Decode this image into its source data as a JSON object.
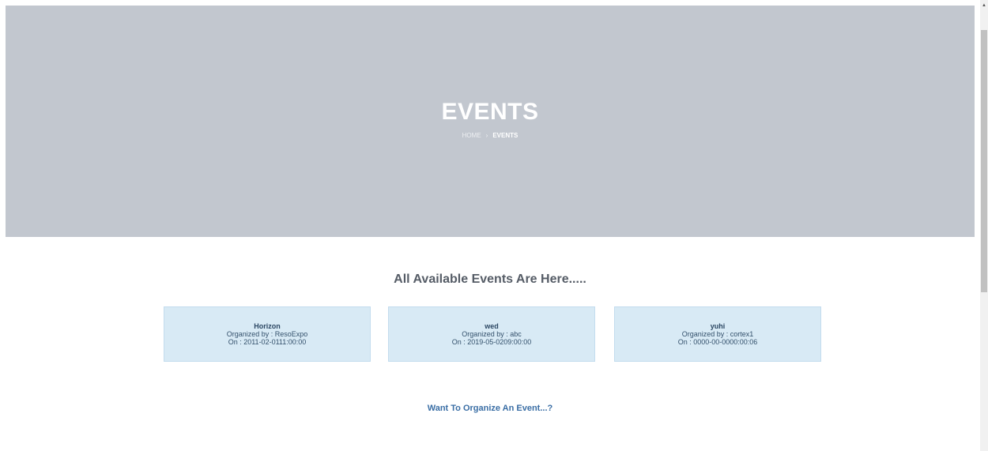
{
  "hero": {
    "title": "EVENTS",
    "breadcrumb": {
      "home": "HOME",
      "separator": "›",
      "current": "EVENTS"
    }
  },
  "main": {
    "section_title": "All Available Events Are Here.....",
    "events": [
      {
        "name": "Horizon",
        "organizer": "Organized by : ResoExpo",
        "date": "On : 2011-02-0111:00:00"
      },
      {
        "name": "wed",
        "organizer": "Organized by : abc",
        "date": "On : 2019-05-0209:00:00"
      },
      {
        "name": "yuhi",
        "organizer": "Organized by : cortex1",
        "date": "On : 0000-00-0000:00:06"
      }
    ],
    "organize_link": "Want To Organize An Event...?"
  },
  "scrollbar": {
    "up_arrow": "▲"
  },
  "colors": {
    "hero_bg": "#c2c7cf",
    "card_bg": "#d8eaf5",
    "link": "#3a6ea5"
  }
}
